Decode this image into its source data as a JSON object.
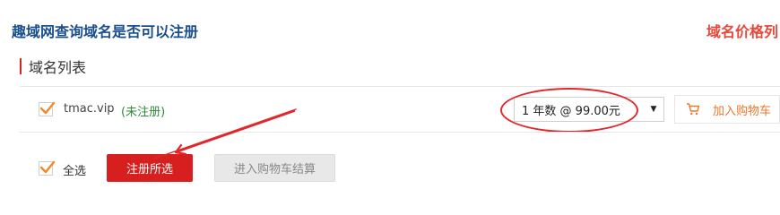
{
  "header": {
    "title": "趣域网查询域名是否可以注册",
    "price_link": "域名价格列"
  },
  "section": {
    "title": "域名列表"
  },
  "domain_row": {
    "checked": true,
    "domain": "tmac.vip",
    "status": "(未注册)",
    "year_select_value": "1 年数 @ 99.00元",
    "add_to_cart_label": "加入购物车"
  },
  "footer": {
    "select_all_checked": true,
    "select_all_label": "全选",
    "register_selected_label": "注册所选",
    "checkout_label": "进入购物车结算"
  },
  "colors": {
    "title_blue": "#1a4f8f",
    "accent_red": "#d71f1f",
    "status_green": "#2f8a3a",
    "cart_orange": "#e8782b",
    "checkbox_orange": "#f08a24"
  },
  "icons": {
    "checkbox": "check-icon",
    "cart": "shopping-cart-icon",
    "select_arrow": "caret-down-icon"
  }
}
